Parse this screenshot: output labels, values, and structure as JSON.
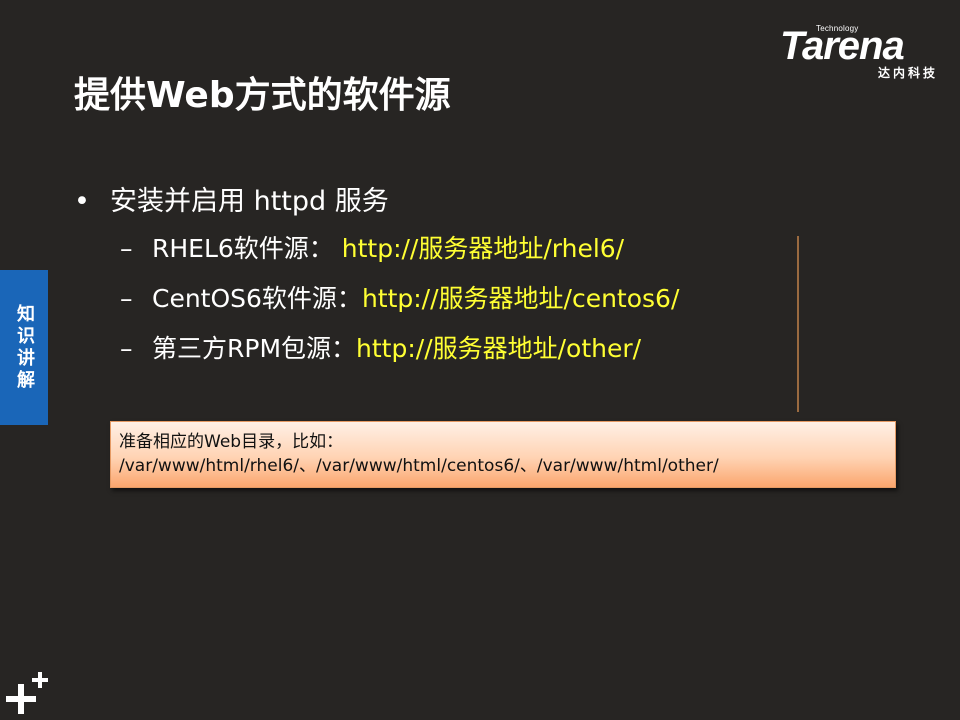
{
  "brand": {
    "tagline": "Technology",
    "name": "Tarena",
    "cn_name": "达内科技"
  },
  "title": "提供Web方式的软件源",
  "side_tab": {
    "label": "知识讲解"
  },
  "bullets": {
    "main": {
      "marker": "•",
      "text": "安装并启用 httpd 服务"
    },
    "sub": [
      {
        "marker": "–",
        "label": "RHEL6软件源： ",
        "url": "http://服务器地址/rhel6/"
      },
      {
        "marker": "–",
        "label": "CentOS6软件源：",
        "url": "http://服务器地址/centos6/"
      },
      {
        "marker": "–",
        "label": "第三方RPM包源：",
        "url": "http://服务器地址/other/"
      }
    ]
  },
  "note": {
    "line1": "准备相应的Web目录，比如：",
    "line2": "/var/www/html/rhel6/、/var/www/html/centos6/、/var/www/html/other/"
  },
  "colors": {
    "background": "#272523",
    "url": "#ffff33",
    "side_tab": "#1a66b8",
    "note_top": "#fff0e6",
    "note_bottom": "#fba66e"
  }
}
